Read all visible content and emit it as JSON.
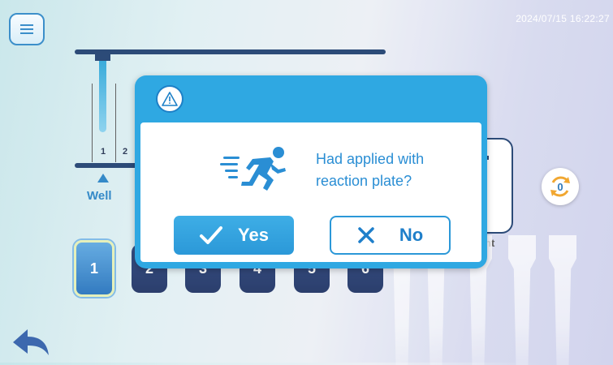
{
  "header": {
    "menu_icon": "hamburger-menu-icon",
    "datetime": "2024/07/15  16:22:27"
  },
  "diagram": {
    "slot_numbers": [
      "1",
      "2"
    ],
    "well_label": "Well",
    "partial_label": "nt"
  },
  "positions": {
    "items": [
      "1",
      "2",
      "3",
      "4",
      "5",
      "6"
    ],
    "selected": "1"
  },
  "refresh": {
    "icon": "refresh-icon",
    "count": "0"
  },
  "navigation": {
    "back_icon": "back-arrow-icon"
  },
  "dialog": {
    "icon": "warning-icon",
    "illustration": "running-person-icon",
    "message_line1": "Had applied with",
    "message_line2": "reaction plate?",
    "yes_label": "Yes",
    "no_label": "No"
  },
  "colors": {
    "accent": "#2fa8e2",
    "dark_navy": "#1b3c6d",
    "message_text": "#2a8ed4"
  }
}
